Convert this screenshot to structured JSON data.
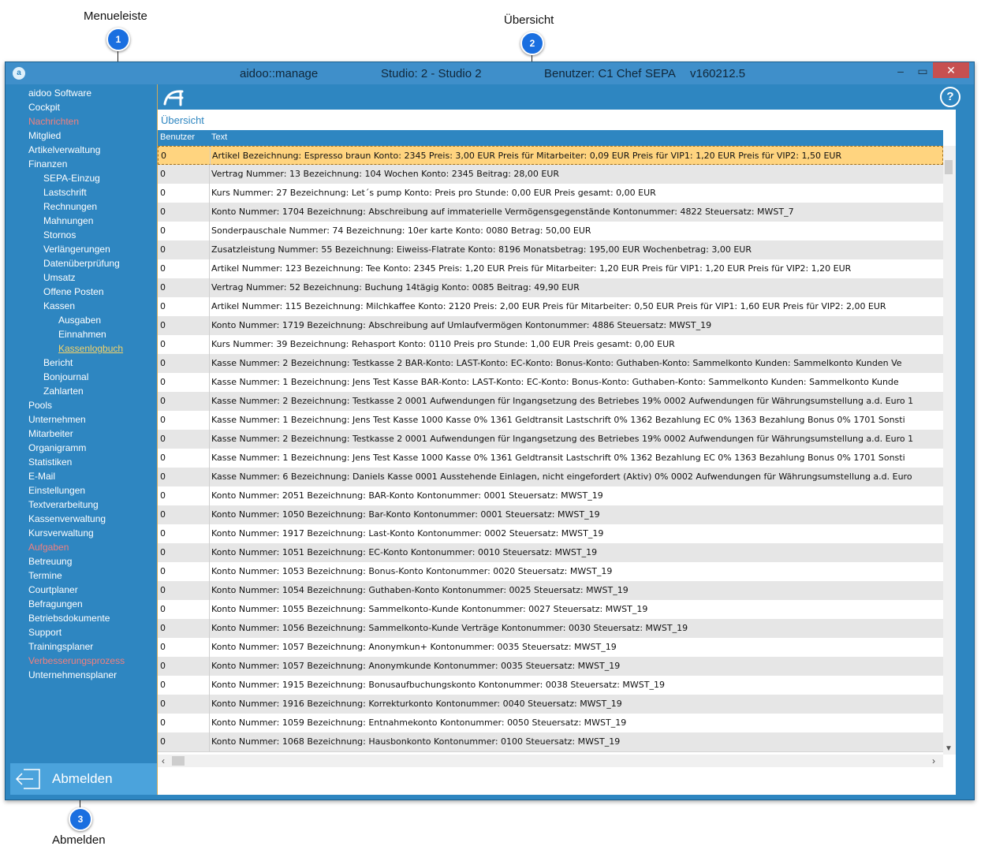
{
  "callouts": [
    {
      "label": "Menueleiste",
      "number": "1"
    },
    {
      "label": "Übersicht",
      "number": "2"
    },
    {
      "label": "Abmelden",
      "number": "3"
    }
  ],
  "titlebar": {
    "app": "aidoo::manage",
    "studio": "Studio: 2 - Studio 2",
    "user": "Benutzer: C1 Chef",
    "mode": "SEPA",
    "version": "v160212.5",
    "minimize": "–",
    "maximize": "▭",
    "close": "✕"
  },
  "sidebar": {
    "items": [
      {
        "label": "aidoo Software",
        "level": 0,
        "state": "normal"
      },
      {
        "label": "Cockpit",
        "level": 0,
        "state": "normal"
      },
      {
        "label": "Nachrichten",
        "level": 0,
        "state": "red"
      },
      {
        "label": "Mitglied",
        "level": 0,
        "state": "normal"
      },
      {
        "label": "Artikelverwaltung",
        "level": 0,
        "state": "normal"
      },
      {
        "label": "Finanzen",
        "level": 0,
        "state": "normal"
      },
      {
        "label": "SEPA-Einzug",
        "level": 1,
        "state": "normal"
      },
      {
        "label": "Lastschrift",
        "level": 1,
        "state": "normal"
      },
      {
        "label": "Rechnungen",
        "level": 1,
        "state": "normal"
      },
      {
        "label": "Mahnungen",
        "level": 1,
        "state": "normal"
      },
      {
        "label": "Stornos",
        "level": 1,
        "state": "normal"
      },
      {
        "label": "Verlängerungen",
        "level": 1,
        "state": "normal"
      },
      {
        "label": "Datenüberprüfung",
        "level": 1,
        "state": "normal"
      },
      {
        "label": "Umsatz",
        "level": 1,
        "state": "normal"
      },
      {
        "label": "Offene Posten",
        "level": 1,
        "state": "normal"
      },
      {
        "label": "Kassen",
        "level": 1,
        "state": "normal"
      },
      {
        "label": "Ausgaben",
        "level": 2,
        "state": "normal"
      },
      {
        "label": "Einnahmen",
        "level": 2,
        "state": "normal"
      },
      {
        "label": "Kassenlogbuch",
        "level": 2,
        "state": "active"
      },
      {
        "label": "Bericht",
        "level": 1,
        "state": "normal"
      },
      {
        "label": "Bonjournal",
        "level": 1,
        "state": "normal"
      },
      {
        "label": "Zahlarten",
        "level": 1,
        "state": "normal"
      },
      {
        "label": "Pools",
        "level": 0,
        "state": "normal"
      },
      {
        "label": "Unternehmen",
        "level": 0,
        "state": "normal"
      },
      {
        "label": "Mitarbeiter",
        "level": 0,
        "state": "normal"
      },
      {
        "label": "Organigramm",
        "level": 0,
        "state": "normal"
      },
      {
        "label": "Statistiken",
        "level": 0,
        "state": "normal"
      },
      {
        "label": "E-Mail",
        "level": 0,
        "state": "normal"
      },
      {
        "label": "Einstellungen",
        "level": 0,
        "state": "normal"
      },
      {
        "label": "Textverarbeitung",
        "level": 0,
        "state": "normal"
      },
      {
        "label": "Kassenverwaltung",
        "level": 0,
        "state": "normal"
      },
      {
        "label": "Kursverwaltung",
        "level": 0,
        "state": "normal"
      },
      {
        "label": "Aufgaben",
        "level": 0,
        "state": "red"
      },
      {
        "label": "Betreuung",
        "level": 0,
        "state": "normal"
      },
      {
        "label": "Termine",
        "level": 0,
        "state": "normal"
      },
      {
        "label": "Courtplaner",
        "level": 0,
        "state": "normal"
      },
      {
        "label": "Befragungen",
        "level": 0,
        "state": "normal"
      },
      {
        "label": "Betriebsdokumente",
        "level": 0,
        "state": "normal"
      },
      {
        "label": "Support",
        "level": 0,
        "state": "normal"
      },
      {
        "label": "Trainingsplaner",
        "level": 0,
        "state": "normal"
      },
      {
        "label": "Verbesserungsprozess",
        "level": 0,
        "state": "red"
      },
      {
        "label": "Unternehmensplaner",
        "level": 0,
        "state": "normal"
      }
    ],
    "logout_label": "Abmelden"
  },
  "main": {
    "title": "Übersicht",
    "help": "?",
    "columns": [
      "Benutzer",
      "Text"
    ],
    "rows": [
      {
        "user": "0",
        "text": "Artikel Bezeichnung: Espresso braun Konto: 2345 Preis: 3,00 EUR Preis für Mitarbeiter: 0,09 EUR Preis für VIP1: 1,20 EUR Preis für VIP2: 1,50 EUR"
      },
      {
        "user": "0",
        "text": "Vertrag Nummer: 13 Bezeichnung: 104 Wochen Konto: 2345 Beitrag: 28,00 EUR"
      },
      {
        "user": "0",
        "text": "Kurs Nummer: 27 Bezeichnung: Let´s pump Konto:  Preis pro Stunde: 0,00 EUR Preis gesamt: 0,00 EUR"
      },
      {
        "user": "0",
        "text": "Konto Nummer: 1704 Bezeichnung: Abschreibung auf immaterielle Vermögensgegenstände Kontonummer: 4822 Steuersatz: MWST_7"
      },
      {
        "user": "0",
        "text": "Sonderpauschale Nummer: 74 Bezeichnung: 10er karte Konto: 0080 Betrag: 50,00 EUR"
      },
      {
        "user": "0",
        "text": "Zusatzleistung Nummer: 55 Bezeichnung: Eiweiss-Flatrate Konto: 8196 Monatsbetrag: 195,00 EUR Wochenbetrag: 3,00 EUR"
      },
      {
        "user": "0",
        "text": "Artikel Nummer: 123 Bezeichnung: Tee Konto: 2345 Preis: 1,20 EUR Preis für Mitarbeiter: 1,20 EUR Preis für VIP1: 1,20 EUR Preis für VIP2: 1,20 EUR"
      },
      {
        "user": "0",
        "text": "Vertrag Nummer: 52 Bezeichnung: Buchung 14tägig Konto: 0085 Beitrag: 49,90 EUR"
      },
      {
        "user": "0",
        "text": "Artikel Nummer: 115 Bezeichnung: Milchkaffee Konto: 2120 Preis: 2,00 EUR Preis für Mitarbeiter: 0,50 EUR Preis für VIP1: 1,60 EUR Preis für VIP2: 2,00 EUR"
      },
      {
        "user": "0",
        "text": "Konto Nummer: 1719 Bezeichnung: Abschreibung auf Umlaufvermögen Kontonummer: 4886 Steuersatz: MWST_19"
      },
      {
        "user": "0",
        "text": "Kurs Nummer: 39 Bezeichnung: Rehasport Konto: 0110 Preis pro Stunde: 1,00 EUR Preis gesamt: 0,00 EUR"
      },
      {
        "user": "0",
        "text": "Kasse Nummer: 2 Bezeichnung: Testkasse 2 BAR-Konto: LAST-Konto: EC-Konto: Bonus-Konto: Guthaben-Konto: Sammelkonto Kunden: Sammelkonto Kunden Ve"
      },
      {
        "user": "0",
        "text": "Kasse Nummer: 1 Bezeichnung: Jens Test Kasse BAR-Konto: LAST-Konto: EC-Konto: Bonus-Konto: Guthaben-Konto: Sammelkonto Kunden: Sammelkonto Kunde"
      },
      {
        "user": "0",
        "text": "Kasse Nummer: 2 Bezeichnung: Testkasse 2 0001 Aufwendungen für Ingangsetzung des Betriebes 19% 0002 Aufwendungen für Währungsumstellung a.d. Euro 1"
      },
      {
        "user": "0",
        "text": "Kasse Nummer: 1 Bezeichnung: Jens Test Kasse 1000 Kasse 0% 1361 Geldtransit Lastschrift 0% 1362 Bezahlung EC 0% 1363 Bezahlung Bonus 0% 1701 Sonsti"
      },
      {
        "user": "0",
        "text": "Kasse Nummer: 2 Bezeichnung: Testkasse 2 0001 Aufwendungen für Ingangsetzung des Betriebes 19% 0002 Aufwendungen für Währungsumstellung a.d. Euro 1"
      },
      {
        "user": "0",
        "text": "Kasse Nummer: 1 Bezeichnung: Jens Test Kasse 1000 Kasse 0% 1361 Geldtransit Lastschrift 0% 1362 Bezahlung EC 0% 1363 Bezahlung Bonus 0% 1701 Sonsti"
      },
      {
        "user": "0",
        "text": "Kasse Nummer: 6 Bezeichnung: Daniels Kasse 0001 Ausstehende Einlagen, nicht eingefordert (Aktiv) 0% 0002 Aufwendungen für Währungsumstellung a.d. Euro"
      },
      {
        "user": "0",
        "text": "Konto Nummer: 2051 Bezeichnung: BAR-Konto Kontonummer: 0001 Steuersatz: MWST_19"
      },
      {
        "user": "0",
        "text": "Konto Nummer: 1050 Bezeichnung: Bar-Konto Kontonummer: 0001 Steuersatz: MWST_19"
      },
      {
        "user": "0",
        "text": "Konto Nummer: 1917 Bezeichnung: Last-Konto Kontonummer: 0002 Steuersatz: MWST_19"
      },
      {
        "user": "0",
        "text": "Konto Nummer: 1051 Bezeichnung: EC-Konto Kontonummer: 0010 Steuersatz: MWST_19"
      },
      {
        "user": "0",
        "text": "Konto Nummer: 1053 Bezeichnung: Bonus-Konto Kontonummer: 0020 Steuersatz: MWST_19"
      },
      {
        "user": "0",
        "text": "Konto Nummer: 1054 Bezeichnung: Guthaben-Konto Kontonummer: 0025 Steuersatz: MWST_19"
      },
      {
        "user": "0",
        "text": "Konto Nummer: 1055 Bezeichnung: Sammelkonto-Kunde Kontonummer: 0027 Steuersatz: MWST_19"
      },
      {
        "user": "0",
        "text": "Konto Nummer: 1056 Bezeichnung: Sammelkonto-Kunde Verträge Kontonummer: 0030 Steuersatz: MWST_19"
      },
      {
        "user": "0",
        "text": "Konto Nummer: 1057 Bezeichnung: Anonymkun+ Kontonummer: 0035 Steuersatz: MWST_19"
      },
      {
        "user": "0",
        "text": "Konto Nummer: 1057 Bezeichnung: Anonymkunde Kontonummer: 0035 Steuersatz: MWST_19"
      },
      {
        "user": "0",
        "text": "Konto Nummer: 1915 Bezeichnung: Bonusaufbuchungskonto Kontonummer: 0038 Steuersatz: MWST_19"
      },
      {
        "user": "0",
        "text": "Konto Nummer: 1916 Bezeichnung: Korrekturkonto Kontonummer: 0040 Steuersatz: MWST_19"
      },
      {
        "user": "0",
        "text": "Konto Nummer: 1059 Bezeichnung: Entnahmekonto Kontonummer: 0050 Steuersatz: MWST_19"
      },
      {
        "user": "0",
        "text": "Konto Nummer: 1068 Bezeichnung: Hausbonkonto Kontonummer: 0100 Steuersatz: MWST_19"
      }
    ]
  },
  "colors": {
    "accent": "#2e86c1",
    "selected_row": "#ffd47f",
    "alert_text": "#f08080",
    "active_link": "#f3d36a"
  }
}
